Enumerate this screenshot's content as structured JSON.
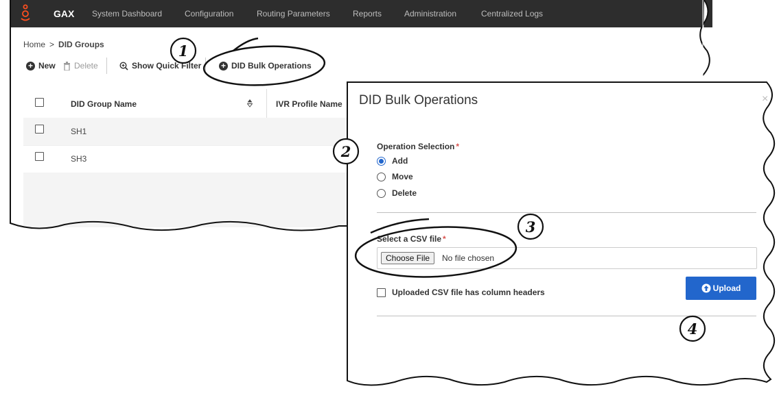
{
  "topbar": {
    "brand": "GAX",
    "nav": [
      "System Dashboard",
      "Configuration",
      "Routing Parameters",
      "Reports",
      "Administration",
      "Centralized Logs"
    ]
  },
  "breadcrumb": {
    "home": "Home",
    "separator": ">",
    "current": "DID Groups"
  },
  "toolbar": {
    "new_label": "New",
    "delete_label": "Delete",
    "quick_filter_label": "Show Quick Filter",
    "bulk_label": "DID Bulk Operations"
  },
  "grid": {
    "columns": [
      "DID Group Name",
      "IVR Profile Name"
    ],
    "rows": [
      {
        "name": "SH1"
      },
      {
        "name": "SH3"
      }
    ]
  },
  "modal": {
    "title": "DID Bulk Operations",
    "close": "×",
    "operation_label": "Operation Selection",
    "required_mark": "*",
    "options": [
      "Add",
      "Move",
      "Delete"
    ],
    "selected_option": "Add",
    "file_label": "Select a CSV file",
    "choose_file": "Choose File",
    "no_file": "No file chosen",
    "upload": "Upload",
    "headers_checkbox": "Uploaded CSV file has column headers",
    "accent_color": "#2266cc"
  },
  "callouts": [
    "1",
    "2",
    "3",
    "4"
  ]
}
